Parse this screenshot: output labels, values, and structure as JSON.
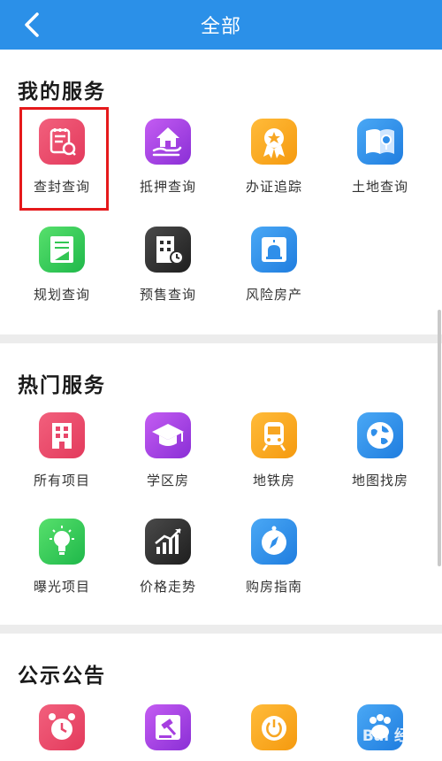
{
  "header": {
    "title": "全部",
    "back_icon": "chevron-left-icon"
  },
  "sections": [
    {
      "title": "我的服务",
      "items": [
        {
          "label": "查封查询",
          "icon": "document-search-icon",
          "color": "#e8466a"
        },
        {
          "label": "抵押查询",
          "icon": "house-hand-icon",
          "color": "#a63fe0"
        },
        {
          "label": "办证追踪",
          "icon": "award-medal-icon",
          "color": "#f7a622"
        },
        {
          "label": "土地查询",
          "icon": "globe-pin-icon",
          "color": "#2f8fea"
        },
        {
          "label": "规划查询",
          "icon": "blueprint-icon",
          "color": "#33c653"
        },
        {
          "label": "预售查询",
          "icon": "building-clock-icon",
          "color": "#2e2e2e"
        },
        {
          "label": "风险房产",
          "icon": "alarm-building-icon",
          "color": "#2f8fea"
        }
      ]
    },
    {
      "title": "热门服务",
      "items": [
        {
          "label": "所有项目",
          "icon": "building-icon",
          "color": "#e8466a"
        },
        {
          "label": "学区房",
          "icon": "graduation-cap-icon",
          "color": "#a63fe0"
        },
        {
          "label": "地铁房",
          "icon": "train-icon",
          "color": "#f7a622"
        },
        {
          "label": "地图找房",
          "icon": "world-map-icon",
          "color": "#2f8fea"
        },
        {
          "label": "曝光项目",
          "icon": "lightbulb-icon",
          "color": "#33c653"
        },
        {
          "label": "价格走势",
          "icon": "trend-chart-icon",
          "color": "#2e2e2e"
        },
        {
          "label": "购房指南",
          "icon": "compass-icon",
          "color": "#2f8fea"
        }
      ]
    },
    {
      "title": "公示公告",
      "items": [
        {
          "label": "",
          "icon": "alarm-clock-icon",
          "color": "#e8466a"
        },
        {
          "label": "",
          "icon": "gavel-icon",
          "color": "#a63fe0"
        },
        {
          "label": "",
          "icon": "power-icon",
          "color": "#f7a622"
        },
        {
          "label": "",
          "icon": "paw-icon",
          "color": "#2f8fea"
        }
      ]
    }
  ],
  "watermark": "Bai 经验"
}
